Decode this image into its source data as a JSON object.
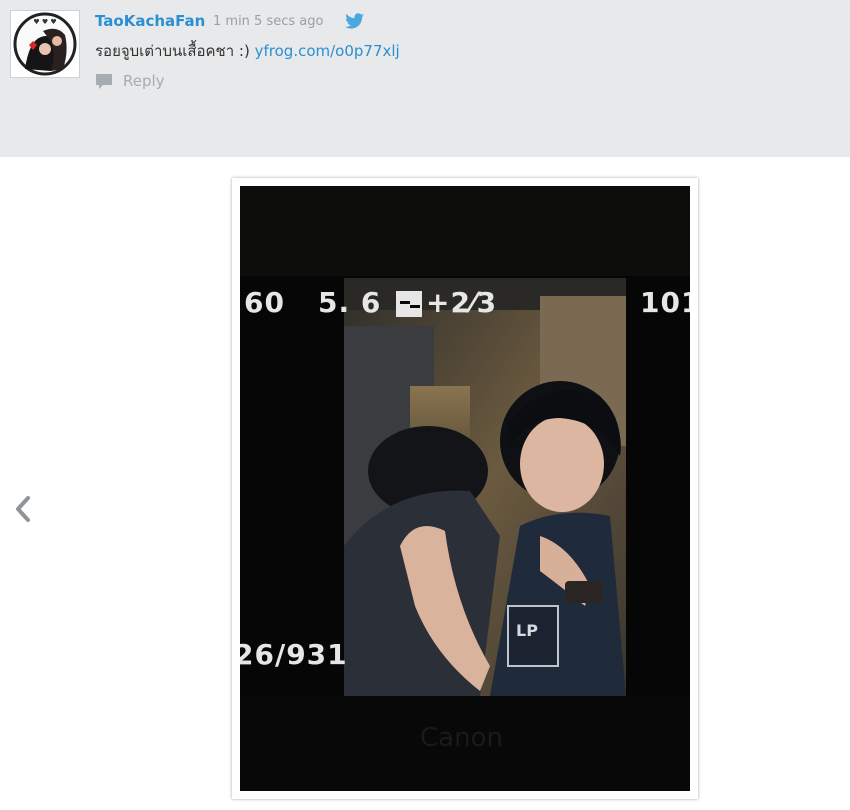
{
  "tweet": {
    "username": "TaoKachaFan",
    "time_ago": "1 min 5 secs ago",
    "text": "รอยจูบเต่าบนเสื้อคชา :)",
    "link": "yfrog.com/o0p77xlj",
    "reply_label": "Reply"
  },
  "photo": {
    "lcd_shutter": "60",
    "lcd_aperture": "5. 6",
    "lcd_exposure": "+2⁄3",
    "lcd_iso": "101",
    "lcd_counter": "26/931"
  },
  "colors": {
    "accent": "#2b8fd3",
    "panel": "#e8e9ea"
  },
  "icons": {
    "reply": "speech-bubble-icon",
    "twitter": "twitter-bird-icon",
    "prev": "chevron-left-icon"
  }
}
